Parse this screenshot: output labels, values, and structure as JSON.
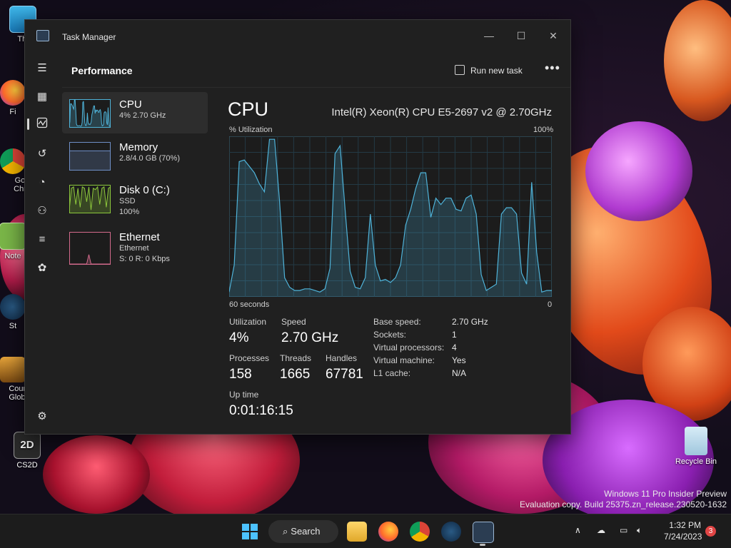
{
  "desktop": {
    "icons": [
      {
        "label": "Thi",
        "icon": "this-pc-icon"
      },
      {
        "label": "Fi",
        "icon": "firefox-icon"
      },
      {
        "label": "Go Chr",
        "icon": "chrome-icon"
      },
      {
        "label": "Note",
        "icon": "notepad-icon"
      },
      {
        "label": "St",
        "icon": "steam-icon"
      },
      {
        "label": "Count Globa",
        "icon": "counter-strike-icon"
      },
      {
        "label": "CS2D",
        "icon": "cs2d-icon"
      }
    ],
    "recycle_bin": "Recycle Bin",
    "watermark": {
      "line1": "Windows 11 Pro Insider Preview",
      "line2": "Evaluation copy. Build 25375.zn_release.230520-1632"
    }
  },
  "window": {
    "title": "Task Manager",
    "controls": {
      "minimize": "—",
      "maximize": "☐",
      "close": "✕"
    }
  },
  "header": {
    "title": "Performance",
    "run_new_task": "Run new task",
    "more": "•••"
  },
  "nav": [
    "menu-icon",
    "processes-icon",
    "performance-icon",
    "app-history-icon",
    "startup-apps-icon",
    "users-icon",
    "details-icon",
    "services-icon",
    "settings-icon"
  ],
  "sidebar": [
    {
      "name": "CPU",
      "sub1": "4% 2.70 GHz",
      "sub2": "",
      "color": "#4fb3d9"
    },
    {
      "name": "Memory",
      "sub1": "2.8/4.0 GB (70%)",
      "sub2": "",
      "color": "#6f8fc7"
    },
    {
      "name": "Disk 0 (C:)",
      "sub1": "SSD",
      "sub2": "100%",
      "color": "#8dc83c"
    },
    {
      "name": "Ethernet",
      "sub1": "Ethernet",
      "sub2": "S: 0 R: 0 Kbps",
      "color": "#d46a8c"
    }
  ],
  "cpu": {
    "title": "CPU",
    "model": "Intel(R) Xeon(R) CPU E5-2697 v2 @ 2.70GHz",
    "y_label": "% Utilization",
    "y_max": "100%",
    "x_label": "60 seconds",
    "x_min": "0",
    "graph_color": "#4fb3d9",
    "utilization_label": "Utilization",
    "utilization": "4%",
    "speed_label": "Speed",
    "speed": "2.70 GHz",
    "processes_label": "Processes",
    "processes": "158",
    "threads_label": "Threads",
    "threads": "1665",
    "handles_label": "Handles",
    "handles": "67781",
    "uptime_label": "Up time",
    "uptime": "0:01:16:15",
    "specs": [
      {
        "k": "Base speed:",
        "v": "2.70 GHz"
      },
      {
        "k": "Sockets:",
        "v": "1"
      },
      {
        "k": "Virtual processors:",
        "v": "4"
      },
      {
        "k": "Virtual machine:",
        "v": "Yes"
      },
      {
        "k": "L1 cache:",
        "v": "N/A"
      }
    ]
  },
  "chart_data": {
    "type": "area",
    "title": "CPU",
    "ylabel": "% Utilization",
    "xlabel": "60 seconds",
    "ylim": [
      0,
      100
    ],
    "x": [
      0,
      1,
      2,
      3,
      4,
      5,
      6,
      7,
      8,
      9,
      10,
      11,
      12,
      13,
      14,
      15,
      16,
      17,
      18,
      19,
      20,
      21,
      22,
      23,
      24,
      25,
      26,
      27,
      28,
      29,
      30,
      31,
      32,
      33,
      34,
      35,
      36,
      37,
      38,
      39,
      40,
      41,
      42,
      43,
      44,
      45,
      46,
      47,
      48,
      49,
      50,
      51,
      52,
      53,
      54,
      55,
      56,
      57,
      58,
      59,
      60
    ],
    "series": [
      {
        "values": [
          3,
          20,
          85,
          86,
          82,
          78,
          71,
          66,
          99,
          99,
          60,
          12,
          6,
          4,
          4,
          5,
          5,
          4,
          3,
          5,
          18,
          90,
          95,
          55,
          16,
          6,
          5,
          12,
          52,
          20,
          10,
          11,
          9,
          12,
          20,
          45,
          55,
          68,
          78,
          78,
          50,
          62,
          58,
          62,
          62,
          55,
          54,
          62,
          64,
          52,
          14,
          4,
          6,
          8,
          52,
          56,
          56,
          52,
          15,
          8,
          72,
          28,
          3,
          4,
          4
        ]
      }
    ]
  },
  "taskbar": {
    "search": "Search",
    "time": "1:32 PM",
    "date": "7/24/2023",
    "notification_count": "3"
  }
}
